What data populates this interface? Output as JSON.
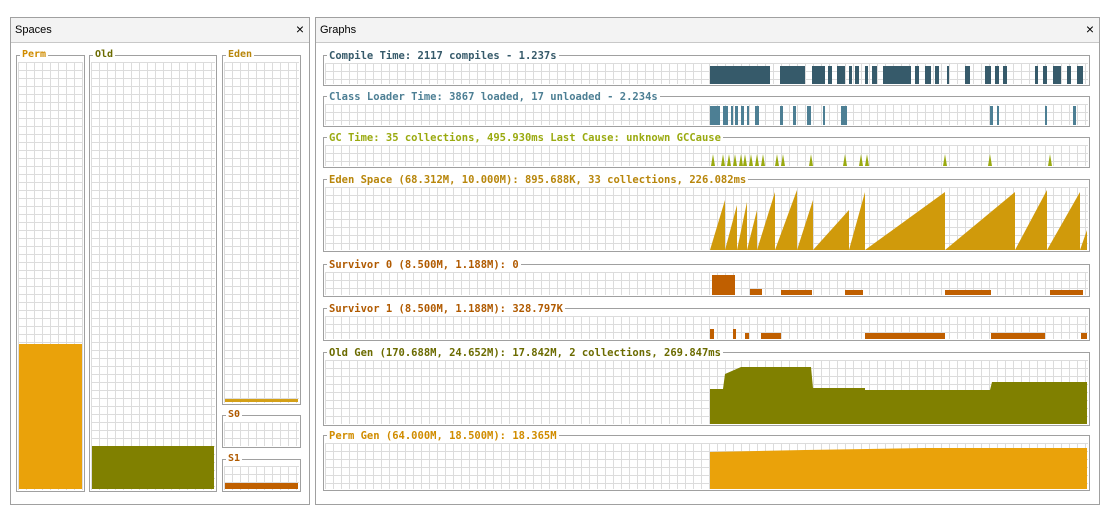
{
  "spaces_panel": {
    "title": "Spaces",
    "close_icon": "close-icon"
  },
  "graphs_panel": {
    "title": "Graphs",
    "close_icon": "close-icon"
  },
  "spaces": {
    "perm": {
      "label": "Perm",
      "color": "#eaa20a",
      "fill_fraction": 0.34
    },
    "old": {
      "label": "Old",
      "color": "#808000",
      "fill_fraction": 0.1
    },
    "eden": {
      "label": "Eden",
      "color": "#d4a017",
      "fill_fraction": 0.01
    },
    "s0": {
      "label": "S0",
      "color": "#c06000",
      "fill_fraction": 0.0
    },
    "s1": {
      "label": "S1",
      "color": "#c06000",
      "fill_fraction": 0.25
    }
  },
  "graphs": [
    {
      "id": "compile",
      "label": "Compile Time: 2117 compiles - 1.237s",
      "color": "#365a6a",
      "label_color": "#365a6a"
    },
    {
      "id": "classloader",
      "label": "Class Loader Time: 3867 loaded, 17 unloaded - 2.234s",
      "color": "#4d7f94",
      "label_color": "#4d7f94"
    },
    {
      "id": "gc",
      "label": "GC Time: 35 collections, 495.930ms Last Cause: unknown GCCause",
      "color": "#9aaa10",
      "label_color": "#9aaa10"
    },
    {
      "id": "eden",
      "label": "Eden Space (68.312M, 10.000M): 895.688K, 33 collections, 226.082ms",
      "color": "#d09a0b",
      "label_color": "#b8860b"
    },
    {
      "id": "survivor0",
      "label": "Survivor 0 (8.500M, 1.188M): 0",
      "color": "#c05f00",
      "label_color": "#b05a00"
    },
    {
      "id": "survivor1",
      "label": "Survivor 1 (8.500M, 1.188M): 328.797K",
      "color": "#c05f00",
      "label_color": "#b05a00"
    },
    {
      "id": "oldgen",
      "label": "Old Gen (170.688M, 24.652M): 17.842M, 2 collections, 269.847ms",
      "color": "#808000",
      "label_color": "#6b6b00"
    },
    {
      "id": "permgen",
      "label": "Perm Gen (64.000M, 18.500M): 18.365M",
      "color": "#eaa20a",
      "label_color": "#d08c00"
    }
  ]
}
